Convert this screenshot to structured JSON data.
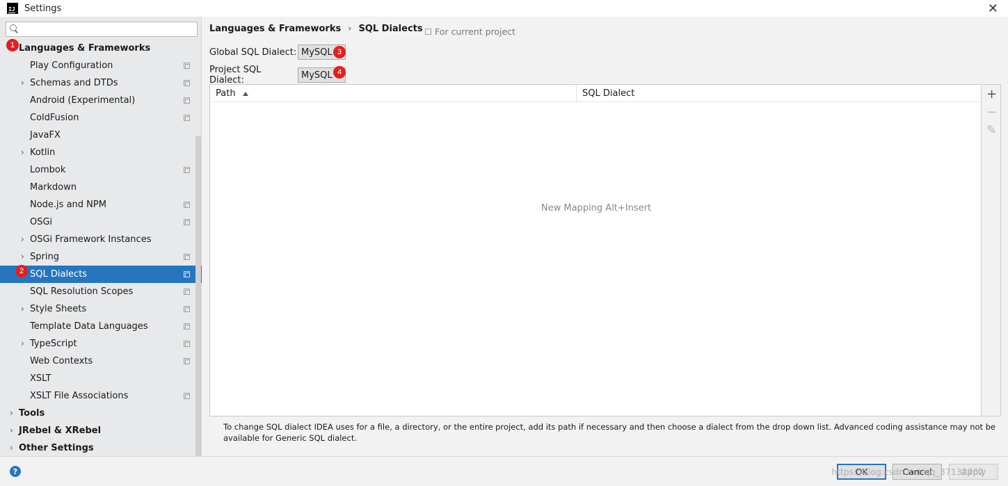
{
  "window": {
    "app_icon_text": "IJ",
    "title": "Settings"
  },
  "search": {
    "placeholder": ""
  },
  "tree": [
    {
      "label": "Languages & Frameworks",
      "level": 1,
      "expanded": true,
      "chevron": "",
      "project": false,
      "badge": "1"
    },
    {
      "label": "Play Configuration",
      "level": 2,
      "chevron": "",
      "project": true
    },
    {
      "label": "Schemas and DTDs",
      "level": 2,
      "chevron": "›",
      "project": true
    },
    {
      "label": "Android (Experimental)",
      "level": 2,
      "chevron": "",
      "project": true
    },
    {
      "label": "ColdFusion",
      "level": 2,
      "chevron": "",
      "project": true
    },
    {
      "label": "JavaFX",
      "level": 2,
      "chevron": "",
      "project": false
    },
    {
      "label": "Kotlin",
      "level": 2,
      "chevron": "›",
      "project": false
    },
    {
      "label": "Lombok",
      "level": 2,
      "chevron": "",
      "project": true
    },
    {
      "label": "Markdown",
      "level": 2,
      "chevron": "",
      "project": false
    },
    {
      "label": "Node.js and NPM",
      "level": 2,
      "chevron": "",
      "project": true
    },
    {
      "label": "OSGi",
      "level": 2,
      "chevron": "",
      "project": true
    },
    {
      "label": "OSGi Framework Instances",
      "level": 2,
      "chevron": "›",
      "project": false
    },
    {
      "label": "Spring",
      "level": 2,
      "chevron": "›",
      "project": true
    },
    {
      "label": "SQL Dialects",
      "level": 2,
      "chevron": "",
      "project": true,
      "selected": true,
      "badge": "2"
    },
    {
      "label": "SQL Resolution Scopes",
      "level": 2,
      "chevron": "",
      "project": true
    },
    {
      "label": "Style Sheets",
      "level": 2,
      "chevron": "›",
      "project": true
    },
    {
      "label": "Template Data Languages",
      "level": 2,
      "chevron": "",
      "project": true
    },
    {
      "label": "TypeScript",
      "level": 2,
      "chevron": "›",
      "project": true
    },
    {
      "label": "Web Contexts",
      "level": 2,
      "chevron": "",
      "project": true
    },
    {
      "label": "XSLT",
      "level": 2,
      "chevron": "",
      "project": false
    },
    {
      "label": "XSLT File Associations",
      "level": 2,
      "chevron": "",
      "project": true
    },
    {
      "label": "Tools",
      "level": 1,
      "chevron": "›",
      "project": false
    },
    {
      "label": "JRebel & XRebel",
      "level": 1,
      "chevron": "›",
      "project": false
    },
    {
      "label": "Other Settings",
      "level": 1,
      "chevron": "›",
      "project": false
    }
  ],
  "breadcrumb": {
    "parent": "Languages & Frameworks",
    "separator": "›",
    "current": "SQL Dialects"
  },
  "for_project": "For current project",
  "global_dialect": {
    "label": "Global SQL Dialect:",
    "value": "MySQL",
    "badge": "3"
  },
  "project_dialect": {
    "label": "Project SQL Dialect:",
    "value": "MySQL",
    "badge": "4"
  },
  "table": {
    "columns": [
      "Path",
      "SQL Dialect"
    ],
    "empty_text": "New Mapping Alt+Insert"
  },
  "tools": {
    "add": "+",
    "remove": "−",
    "edit": "✎"
  },
  "help_text": "To change SQL dialect IDEA uses for a file, a directory, or the entire project, add its path if necessary and then choose a dialect from the drop down list. Advanced coding assistance may not be available for Generic SQL dialect.",
  "buttons": {
    "help": "?",
    "ok": "OK",
    "cancel": "Cancel",
    "apply": "Apply"
  },
  "watermark": "https://blog.csdn.net/qq_37132702",
  "colors": {
    "selection": "#2675bf",
    "badge": "#e02020"
  }
}
